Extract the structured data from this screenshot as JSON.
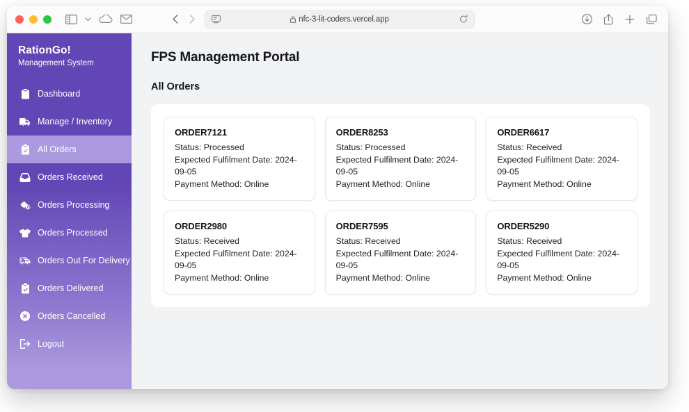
{
  "browser": {
    "traffic_lights": [
      "close",
      "minimize",
      "zoom"
    ],
    "left_icons": [
      "sidebar-toggle-icon",
      "chevron-down-icon",
      "icloud-icon",
      "mail-icon"
    ],
    "back_label": "Back",
    "forward_label": "Forward",
    "reader_icon": "reader-view-icon",
    "lock_icon": "lock-icon",
    "url": "nfc-3-lit-coders.vercel.app",
    "reload_icon": "reload-icon",
    "right_icons": [
      "downloads-icon",
      "share-icon",
      "new-tab-icon",
      "tab-overview-icon"
    ]
  },
  "sidebar": {
    "brand_title": "RationGo!",
    "brand_subtitle": "Management System",
    "active_index": 2,
    "items": [
      {
        "label": "Dashboard",
        "icon": "clipboard-list-icon"
      },
      {
        "label": "Manage / Inventory",
        "icon": "truck-icon"
      },
      {
        "label": "All Orders",
        "icon": "clipboard-check-icon"
      },
      {
        "label": "Orders Received",
        "icon": "inbox-icon"
      },
      {
        "label": "Orders Processing",
        "icon": "cogs-icon"
      },
      {
        "label": "Orders Processed",
        "icon": "tshirt-icon"
      },
      {
        "label": "Orders Out For Delivery",
        "icon": "shipping-fast-icon"
      },
      {
        "label": "Orders Delivered",
        "icon": "clipboard-check-icon"
      },
      {
        "label": "Orders Cancelled",
        "icon": "times-circle-icon"
      },
      {
        "label": "Logout",
        "icon": "sign-out-icon"
      }
    ]
  },
  "main": {
    "page_title": "FPS Management Portal",
    "section_title": "All Orders",
    "labels": {
      "status": "Status:",
      "date": "Expected Fulfilment Date:",
      "payment": "Payment Method:"
    },
    "orders": [
      {
        "id": "ORDER7121",
        "status": "Processed",
        "date": "2024-09-05",
        "payment": "Online"
      },
      {
        "id": "ORDER8253",
        "status": "Processed",
        "date": "2024-09-05",
        "payment": "Online"
      },
      {
        "id": "ORDER6617",
        "status": "Received",
        "date": "2024-09-05",
        "payment": "Online"
      },
      {
        "id": "ORDER2980",
        "status": "Received",
        "date": "2024-09-05",
        "payment": "Online"
      },
      {
        "id": "ORDER7595",
        "status": "Received",
        "date": "2024-09-05",
        "payment": "Online"
      },
      {
        "id": "ORDER5290",
        "status": "Received",
        "date": "2024-09-05",
        "payment": "Online"
      }
    ]
  },
  "colors": {
    "brand_purple": "#6246b5",
    "active_purple": "#ab9add",
    "page_background": "#f2f3f5",
    "card_background": "#ffffff",
    "text_dark": "#15171a"
  }
}
